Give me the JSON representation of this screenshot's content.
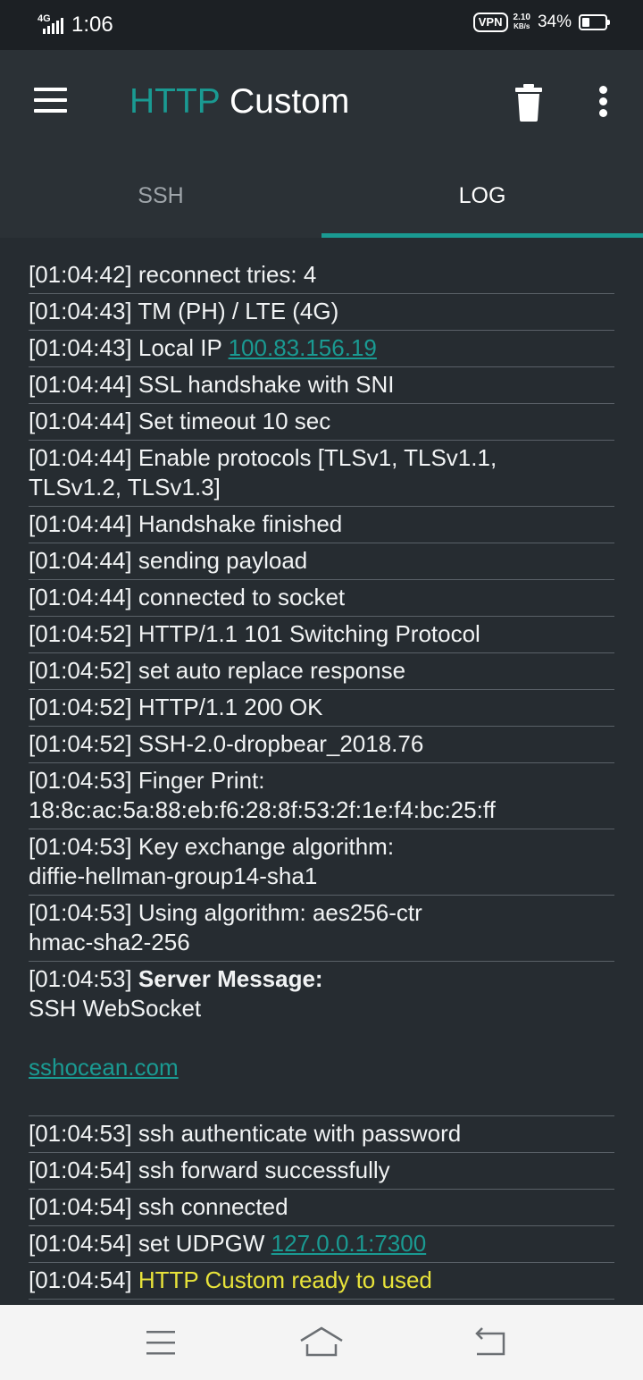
{
  "status_bar": {
    "network_type": "4G",
    "time": "1:06",
    "vpn": "VPN",
    "speed_value": "2.10",
    "speed_unit": "KB/s",
    "battery": "34%",
    "battery_level": 0.34
  },
  "app_bar": {
    "title_accent": "HTTP",
    "title_rest": " Custom",
    "menu_icon": "hamburger-menu-icon",
    "delete_icon": "trash-icon",
    "more_icon": "more-vertical-icon"
  },
  "tabs": [
    {
      "label": "SSH",
      "active": false
    },
    {
      "label": "LOG",
      "active": true
    }
  ],
  "colors": {
    "accent": "#1a9a92",
    "background": "#262c31",
    "highlight": "#e8e33a"
  },
  "log": [
    {
      "ts": "[01:04:42]",
      "text": " reconnect tries: 4"
    },
    {
      "ts": "[01:04:43]",
      "text": " TM (PH) / LTE (4G)"
    },
    {
      "ts": "[01:04:43]",
      "text": " Local IP ",
      "link": "100.83.156.19"
    },
    {
      "ts": "[01:04:44]",
      "text": " SSL handshake with SNI"
    },
    {
      "ts": "[01:04:44]",
      "text": " Set timeout 10 sec"
    },
    {
      "ts": "[01:04:44]",
      "text": " Enable protocols [TLSv1, TLSv1.1,",
      "line2": "TLSv1.2, TLSv1.3]"
    },
    {
      "ts": "[01:04:44]",
      "text": " Handshake finished"
    },
    {
      "ts": "[01:04:44]",
      "text": " sending payload"
    },
    {
      "ts": "[01:04:44]",
      "text": " connected to socket"
    },
    {
      "ts": "[01:04:52]",
      "text": " HTTP/1.1 101 Switching Protocol"
    },
    {
      "ts": "[01:04:52]",
      "text": " set auto replace response"
    },
    {
      "ts": "[01:04:52]",
      "text": " HTTP/1.1 200 OK"
    },
    {
      "ts": "[01:04:52]",
      "text": " SSH-2.0-dropbear_2018.76"
    },
    {
      "ts": "[01:04:53]",
      "text": " Finger Print:",
      "line2": "18:8c:ac:5a:88:eb:f6:28:8f:53:2f:1e:f4:bc:25:ff"
    },
    {
      "ts": "[01:04:53]",
      "text": " Key exchange algorithm:",
      "line2": "diffie-hellman-group14-sha1"
    },
    {
      "ts": "[01:04:53]",
      "text": " Using algorithm: aes256-ctr",
      "line2": "hmac-sha2-256"
    },
    {
      "ts": "[01:04:53]",
      "bold": "Server Message:",
      "line2": "SSH WebSocket",
      "link_line": "sshocean.com"
    },
    {
      "ts": "[01:04:53]",
      "text": " ssh authenticate with password"
    },
    {
      "ts": "[01:04:54]",
      "text": " ssh forward successfully"
    },
    {
      "ts": "[01:04:54]",
      "text": " ssh connected"
    },
    {
      "ts": "[01:04:54]",
      "text": " set UDPGW ",
      "link": "127.0.0.1:7300"
    },
    {
      "ts": "[01:04:54]",
      "highlight": " HTTP Custom ready to used"
    }
  ],
  "nav_bar": {
    "recents_icon": "recents-menu-icon",
    "home_icon": "home-icon",
    "back_icon": "back-icon"
  }
}
